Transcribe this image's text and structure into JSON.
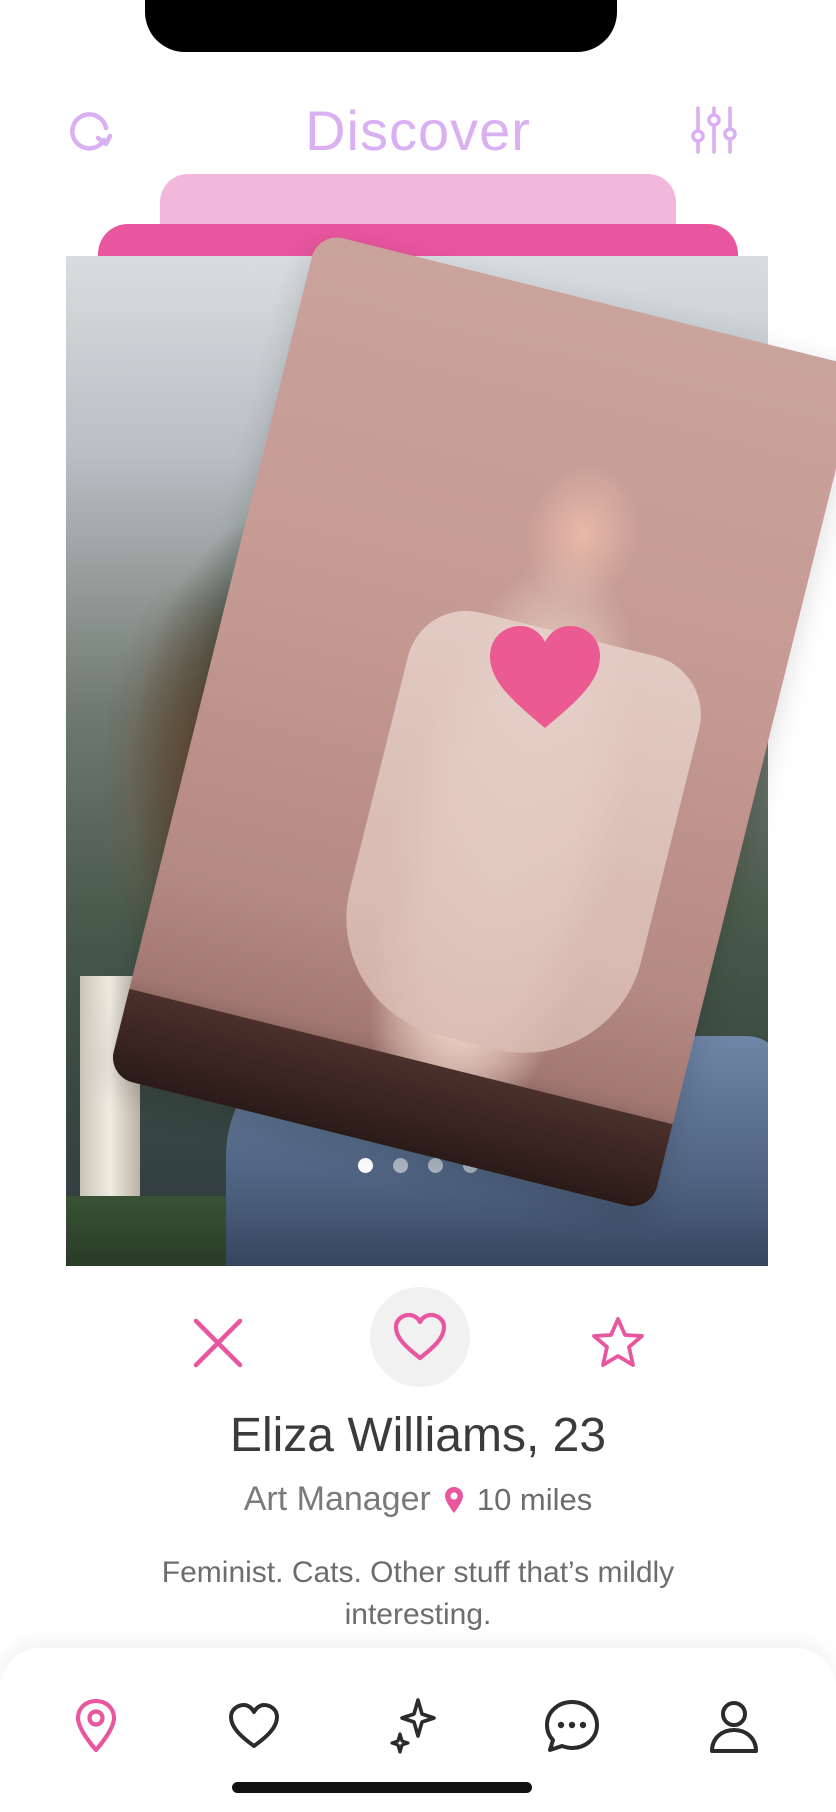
{
  "header": {
    "title": "Discover",
    "refresh_icon": "refresh-icon",
    "filter_icon": "filter-sliders-icon",
    "accent": "#d9b0f2"
  },
  "card": {
    "photo_count": 4,
    "active_photo_index": 0,
    "swipe_overlay_icon": "heart-icon",
    "swipe_direction": "right"
  },
  "actions": {
    "dislike_icon": "close-icon",
    "like_icon": "heart-icon",
    "superlike_icon": "star-icon",
    "accent": "#e8569f"
  },
  "profile": {
    "name_age": "Eliza Williams, 23",
    "job": "Art Manager",
    "location_icon": "location-pin-icon",
    "distance": "10 miles",
    "bio": "Feminist. Cats. Other stuff that’s mildly interesting."
  },
  "nav": {
    "items": [
      {
        "icon": "location-pin-icon",
        "active": true
      },
      {
        "icon": "heart-icon",
        "active": false
      },
      {
        "icon": "sparkle-icon",
        "active": false
      },
      {
        "icon": "chat-icon",
        "active": false
      },
      {
        "icon": "user-icon",
        "active": false
      }
    ],
    "active_color": "#e8569f",
    "inactive_color": "#2b2b2b"
  }
}
